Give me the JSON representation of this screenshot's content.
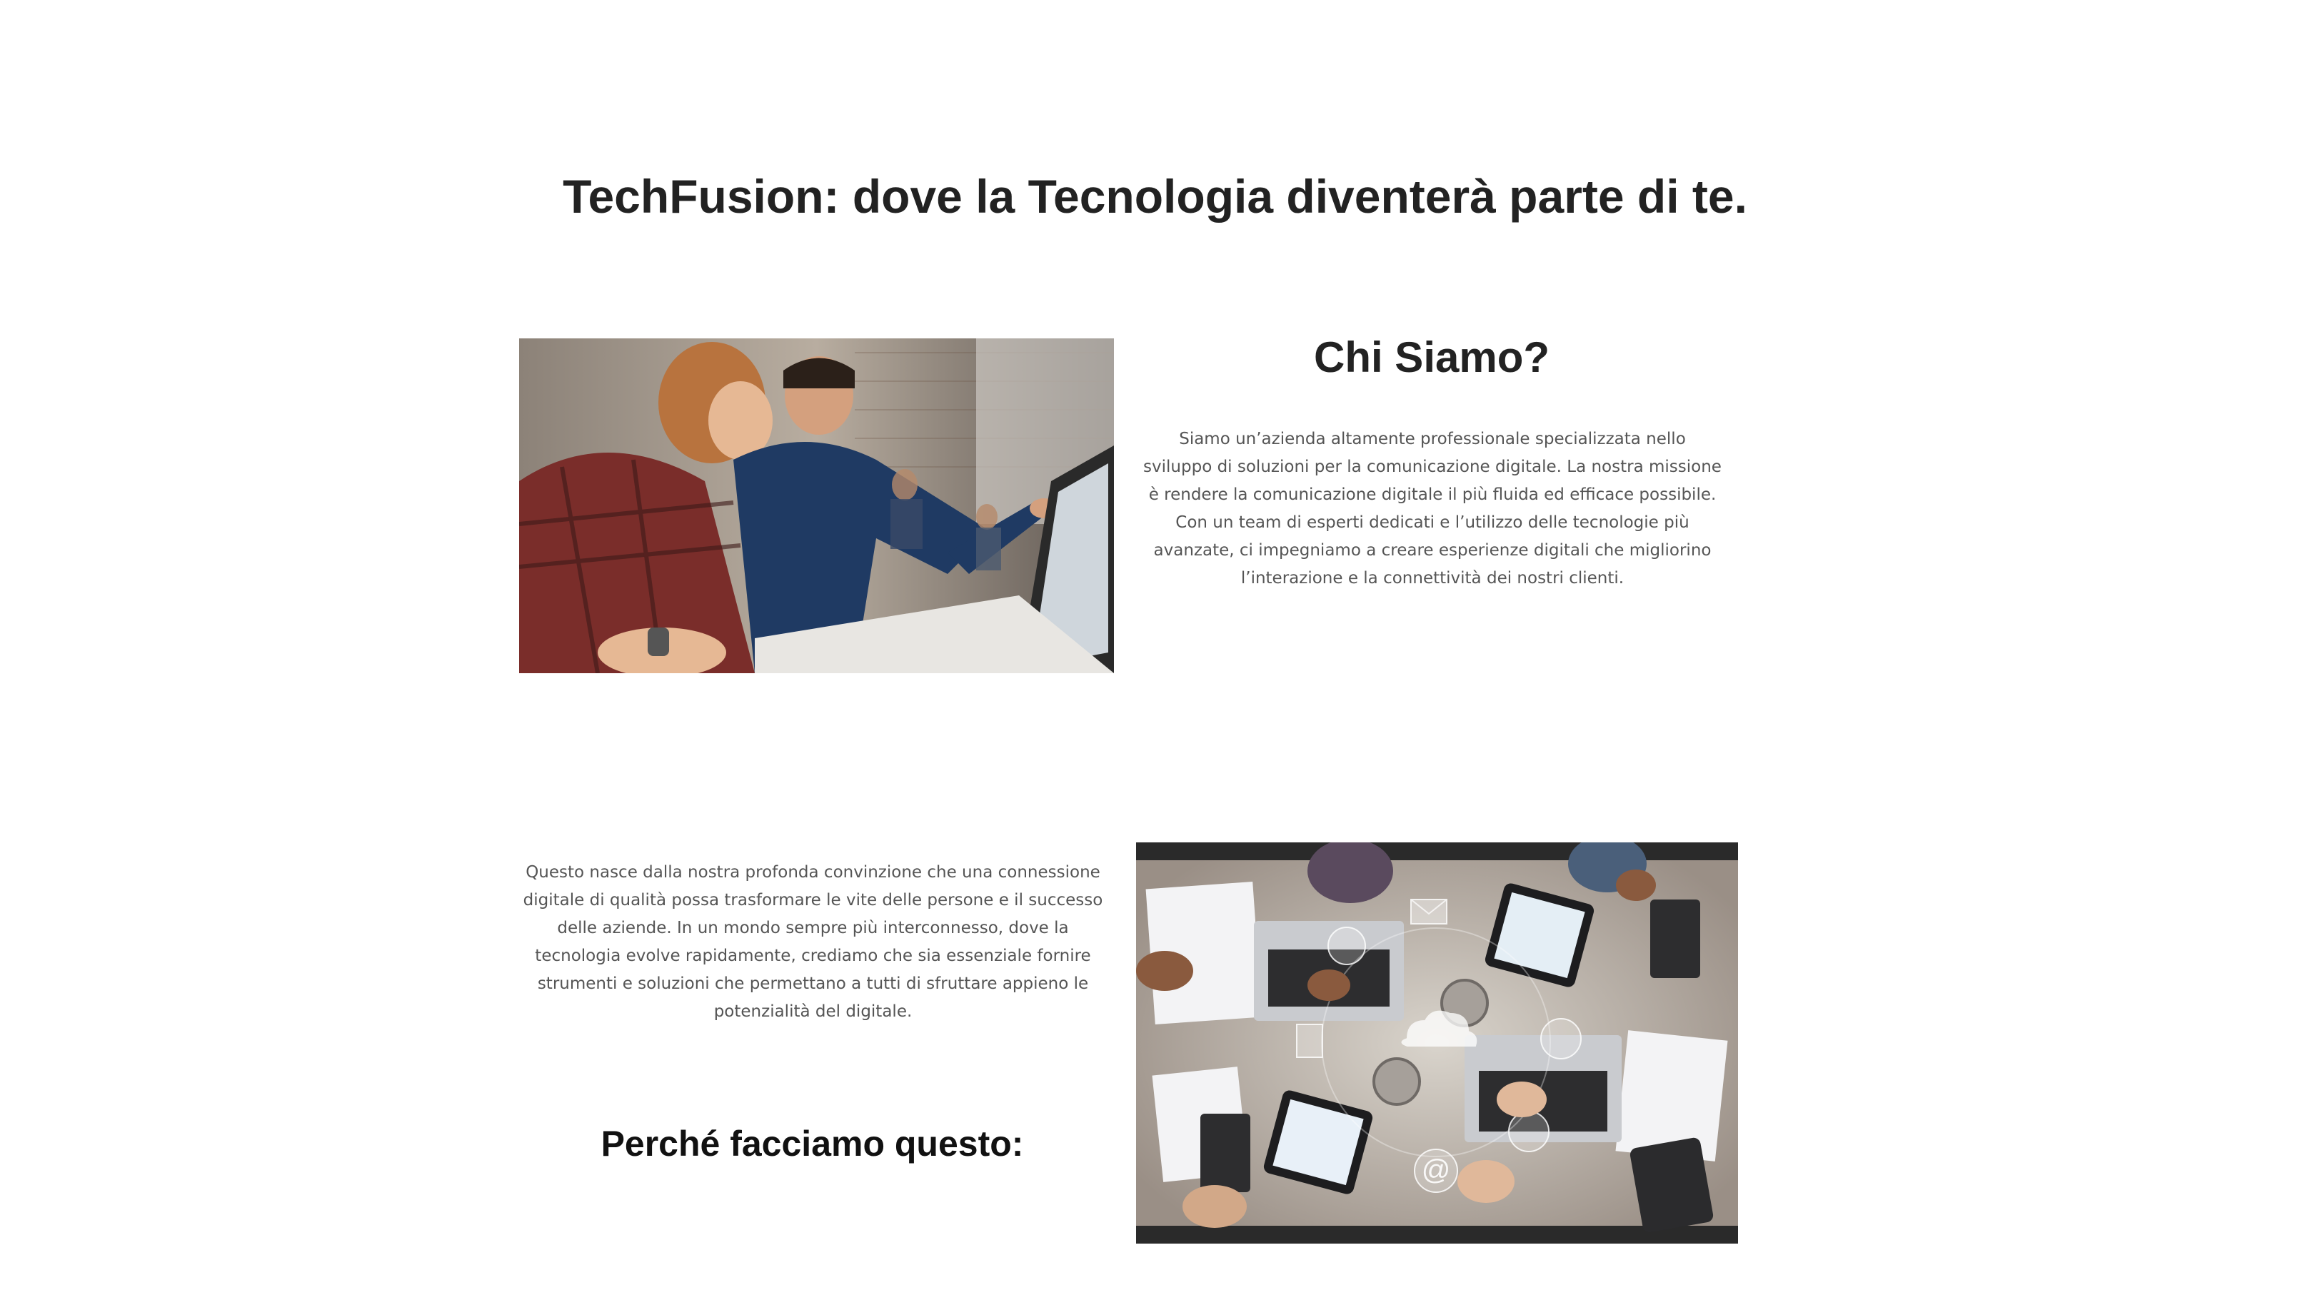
{
  "page": {
    "main_title": "TechFusion: dove la Tecnologia diventerà parte di te."
  },
  "about": {
    "title": "Chi Siamo?",
    "text": "Siamo un’azienda altamente professionale specializzata nello sviluppo di soluzioni per la comunicazione digitale. La nostra missione è rendere la comunicazione digitale il più fluida ed efficace possibile. Con un team di esperti dedicati e l’utilizzo delle tecnologie più avanzate, ci impegniamo a creare esperienze digitali che migliorino l’interazione e la connettività dei nostri clienti."
  },
  "why": {
    "intro_text": "Questo nasce dalla nostra profonda convinzione che una connessione digitale di qualità possa trasformare le vite delle persone e il successo delle aziende. In un mondo sempre più interconnesso, dove la tecnologia evolve rapidamente, crediamo che sia essenziale fornire strumenti e soluzioni che permettano a tutti di sfruttare appieno le potenzialità del digitale.",
    "title": "Perché facciamo questo:"
  },
  "icons": {
    "team_photo": "team-working-photo",
    "business_photo": "business-meeting-digital-icons-photo"
  },
  "colors": {
    "heading": "#222222",
    "body_text": "#555555",
    "background": "#ffffff"
  }
}
